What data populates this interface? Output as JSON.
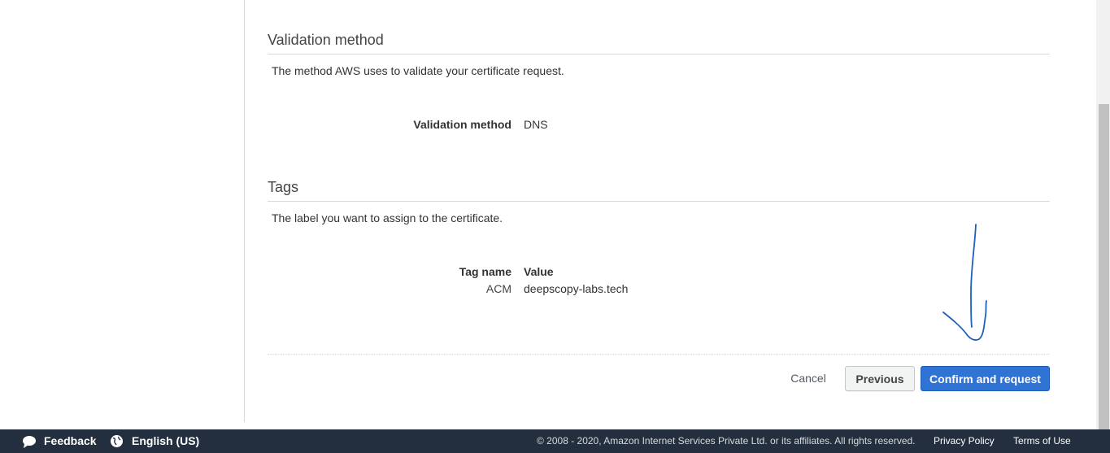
{
  "validation": {
    "title": "Validation method",
    "description": "The method AWS uses to validate your certificate request.",
    "field_label": "Validation method",
    "field_value": "DNS"
  },
  "tags": {
    "title": "Tags",
    "description": "The label you want to assign to the certificate.",
    "header_name": "Tag name",
    "header_value": "Value",
    "rows": [
      {
        "name": "ACM",
        "value": "deepscopy-labs.tech"
      }
    ]
  },
  "actions": {
    "cancel_label": "Cancel",
    "previous_label": "Previous",
    "confirm_label": "Confirm and request"
  },
  "footer": {
    "feedback_label": "Feedback",
    "language_label": "English (US)",
    "copyright": "© 2008 - 2020, Amazon Internet Services Private Ltd. or its affiliates. All rights reserved.",
    "privacy_label": "Privacy Policy",
    "terms_label": "Terms of Use"
  },
  "icons": {
    "feedback": "speech-bubble-icon",
    "language": "globe-icon"
  },
  "colors": {
    "primary_button": "#2f73d4",
    "footer_bg": "#232f3e",
    "annotation_stroke": "#1f5fbf"
  }
}
